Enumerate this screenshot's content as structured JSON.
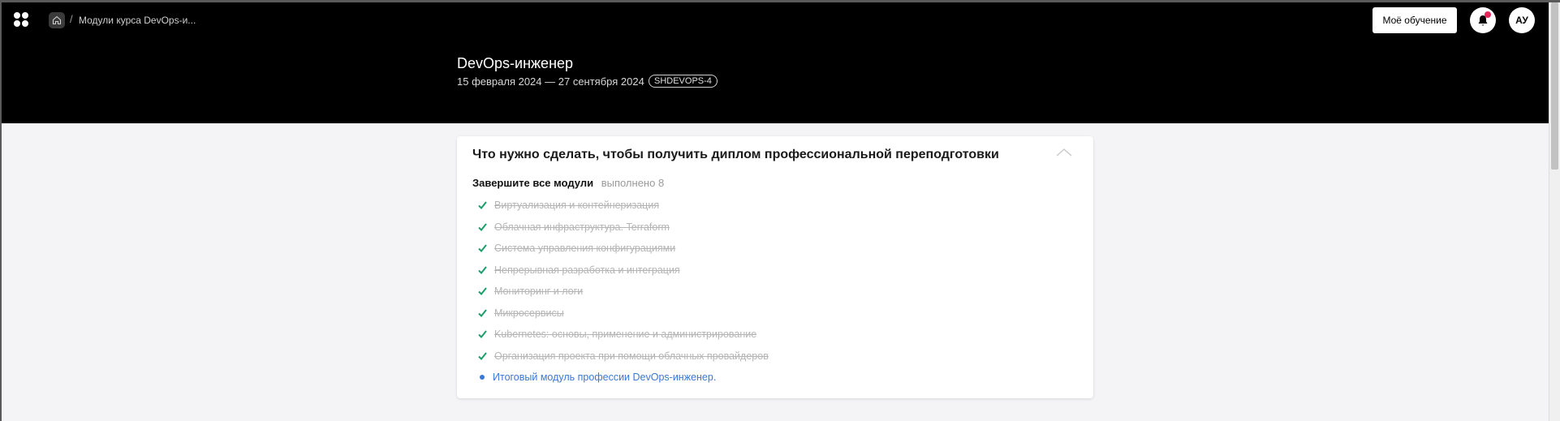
{
  "header": {
    "breadcrumb": "Модули курса DevOps-и...",
    "breadcrumb_separator": "/",
    "my_learning_button": "Моё обучение",
    "avatar_initials": "АУ",
    "notification_dot_color": "#e8245a"
  },
  "course": {
    "title": "DevOps-инженер",
    "dates": "15 февраля 2024 — 27 сентября 2024",
    "code": "SHDEVOPS-4"
  },
  "card": {
    "title": "Что нужно сделать, чтобы получить диплом профессиональной переподготовки",
    "modules_label": "Завершите все модули",
    "modules_status": "выполнено 8",
    "modules": [
      {
        "name": "Виртуализация и контейнеризация",
        "done": true
      },
      {
        "name": "Облачная инфраструктура. Terraform",
        "done": true
      },
      {
        "name": "Система управления конфигурациями",
        "done": true
      },
      {
        "name": "Непрерывная разработка и интеграция",
        "done": true
      },
      {
        "name": "Мониторинг и логи",
        "done": true
      },
      {
        "name": "Микросервисы",
        "done": true
      },
      {
        "name": "Kubernetes: основы, применение и администрирование",
        "done": true
      },
      {
        "name": "Организация проекта при помощи облачных провайдеров",
        "done": true
      },
      {
        "name": "Итоговый модуль профессии DevOps-инженер.",
        "done": false
      }
    ]
  },
  "colors": {
    "header_bg": "#000000",
    "check": "#1a9e6a",
    "link": "#3a78d6",
    "done_text": "#b5b5b5"
  }
}
